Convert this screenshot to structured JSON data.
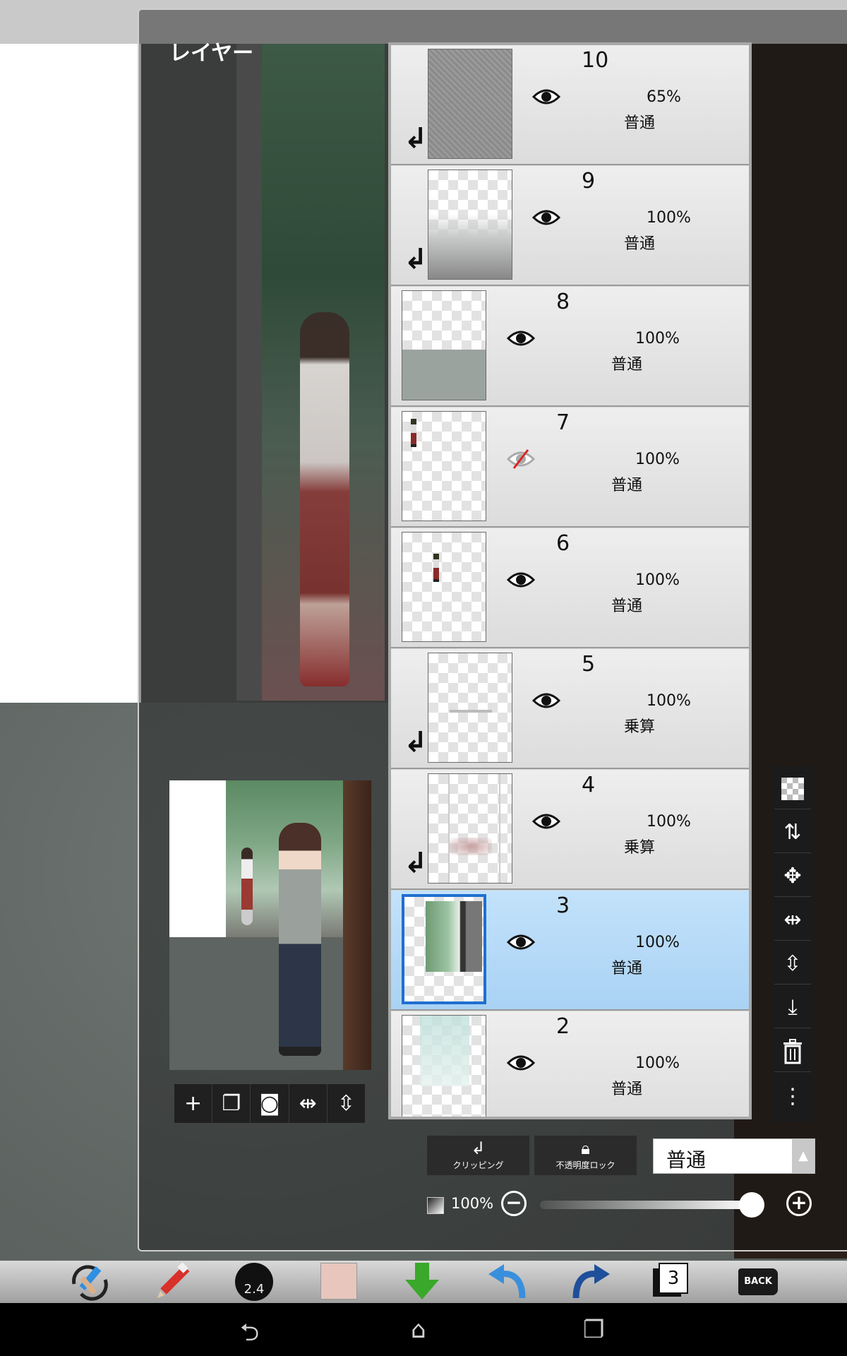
{
  "panel": {
    "title": "レイヤー"
  },
  "layers": [
    {
      "number": "10",
      "opacity": "65%",
      "blend": "普通",
      "visible": true,
      "clipped": true,
      "selected": false,
      "thumb": "noise"
    },
    {
      "number": "9",
      "opacity": "100%",
      "blend": "普通",
      "visible": true,
      "clipped": true,
      "selected": false,
      "thumb": "fog"
    },
    {
      "number": "8",
      "opacity": "100%",
      "blend": "普通",
      "visible": true,
      "clipped": false,
      "selected": false,
      "thumb": "grey-half"
    },
    {
      "number": "7",
      "opacity": "100%",
      "blend": "普通",
      "visible": false,
      "clipped": false,
      "selected": false,
      "thumb": "tiny-figure"
    },
    {
      "number": "6",
      "opacity": "100%",
      "blend": "普通",
      "visible": true,
      "clipped": false,
      "selected": false,
      "thumb": "tiny-figure"
    },
    {
      "number": "5",
      "opacity": "100%",
      "blend": "乗算",
      "visible": true,
      "clipped": true,
      "selected": false,
      "thumb": "smudge"
    },
    {
      "number": "4",
      "opacity": "100%",
      "blend": "乗算",
      "visible": true,
      "clipped": true,
      "selected": false,
      "thumb": "frame"
    },
    {
      "number": "3",
      "opacity": "100%",
      "blend": "普通",
      "visible": true,
      "clipped": false,
      "selected": true,
      "thumb": "scene"
    },
    {
      "number": "2",
      "opacity": "100%",
      "blend": "普通",
      "visible": true,
      "clipped": false,
      "selected": false,
      "thumb": "teal"
    }
  ],
  "controls": {
    "clipping_label": "クリッピング",
    "alpha_lock_label": "不透明度ロック",
    "blend_mode_value": "普通",
    "opacity_value": "100%",
    "opacity_level": 1.0
  },
  "side_tools": [
    "transparent-icon",
    "swap-icon",
    "move-icon",
    "flip-horizontal-icon",
    "flip-vertical-icon",
    "merge-down-icon",
    "trash-icon",
    "more-icon"
  ],
  "preview_tools": [
    "add-icon",
    "duplicate-icon",
    "camera-icon",
    "flip-horizontal-icon",
    "flip-vertical-icon"
  ],
  "toolbar": {
    "brush_size": "2.4",
    "layer_count": "3",
    "back_label": "BACK",
    "current_color": "#e8c6bd"
  },
  "colors": {
    "selected_row": "#b3d8f7",
    "selected_border": "#1f6fd0",
    "panel_title": "#ffffff"
  }
}
